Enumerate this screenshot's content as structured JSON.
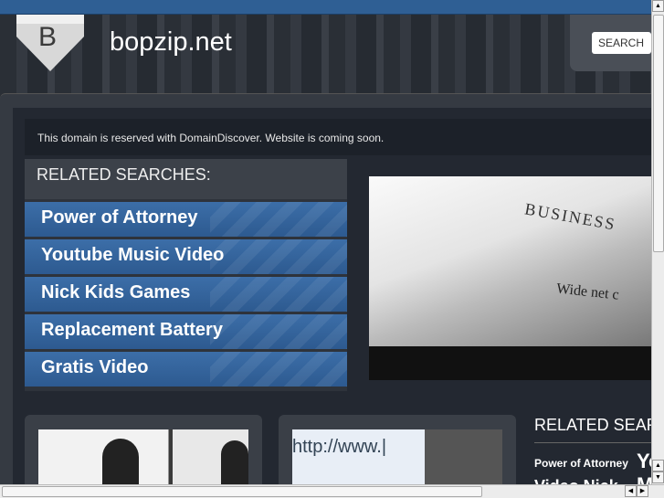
{
  "header": {
    "site_name": "bopzip.net",
    "logo_letter": "B",
    "search_label": "SEARCH"
  },
  "notice": "This domain is reserved with DomainDiscover. Website is coming soon.",
  "related": {
    "title": "RELATED SEARCHES:",
    "items": [
      {
        "label": "Power of Attorney"
      },
      {
        "label": "Youtube Music Video"
      },
      {
        "label": "Nick Kids Games"
      },
      {
        "label": "Replacement Battery"
      },
      {
        "label": "Gratis Video"
      }
    ]
  },
  "hero": {
    "headline": "BUSINESS",
    "subline": "Wide net c"
  },
  "thumbs": {
    "http_text": "http://www.|"
  },
  "related2": {
    "title": "RELATED SEARCHES:",
    "item1": "Power of Attorney",
    "item2": "Youtube Music Video",
    "item3": "Video  Nick Kids Games"
  }
}
